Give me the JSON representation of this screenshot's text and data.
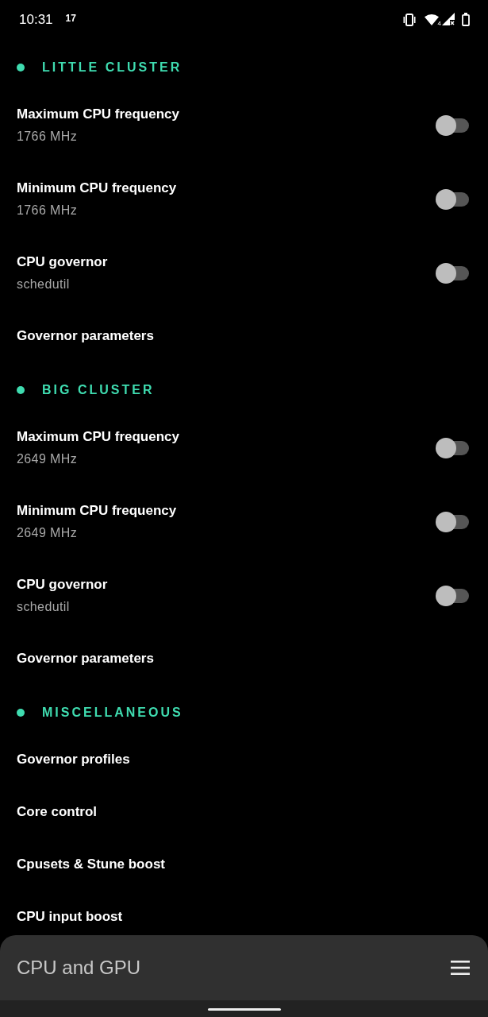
{
  "status_bar": {
    "time": "10:31",
    "notification_count": "17",
    "wifi_label": "4"
  },
  "sections": [
    {
      "title": "LITTLE CLUSTER",
      "items": [
        {
          "kind": "switch",
          "title": "Maximum CPU frequency",
          "value": "1766 MHz",
          "on": false
        },
        {
          "kind": "switch",
          "title": "Minimum CPU frequency",
          "value": "1766 MHz",
          "on": false
        },
        {
          "kind": "switch",
          "title": "CPU governor",
          "value": "schedutil",
          "on": false
        },
        {
          "kind": "link",
          "title": "Governor parameters"
        }
      ]
    },
    {
      "title": "BIG CLUSTER",
      "items": [
        {
          "kind": "switch",
          "title": "Maximum CPU frequency",
          "value": "2649 MHz",
          "on": false
        },
        {
          "kind": "switch",
          "title": "Minimum CPU frequency",
          "value": "2649 MHz",
          "on": false
        },
        {
          "kind": "switch",
          "title": "CPU governor",
          "value": "schedutil",
          "on": false
        },
        {
          "kind": "link",
          "title": "Governor parameters"
        }
      ]
    },
    {
      "title": "MISCELLANEOUS",
      "items": [
        {
          "kind": "link",
          "title": "Governor profiles"
        },
        {
          "kind": "link",
          "title": "Core control"
        },
        {
          "kind": "link",
          "title": "Cpusets & Stune boost"
        },
        {
          "kind": "link",
          "title": "CPU input boost"
        }
      ]
    }
  ],
  "bottom_bar": {
    "title": "CPU and GPU"
  }
}
